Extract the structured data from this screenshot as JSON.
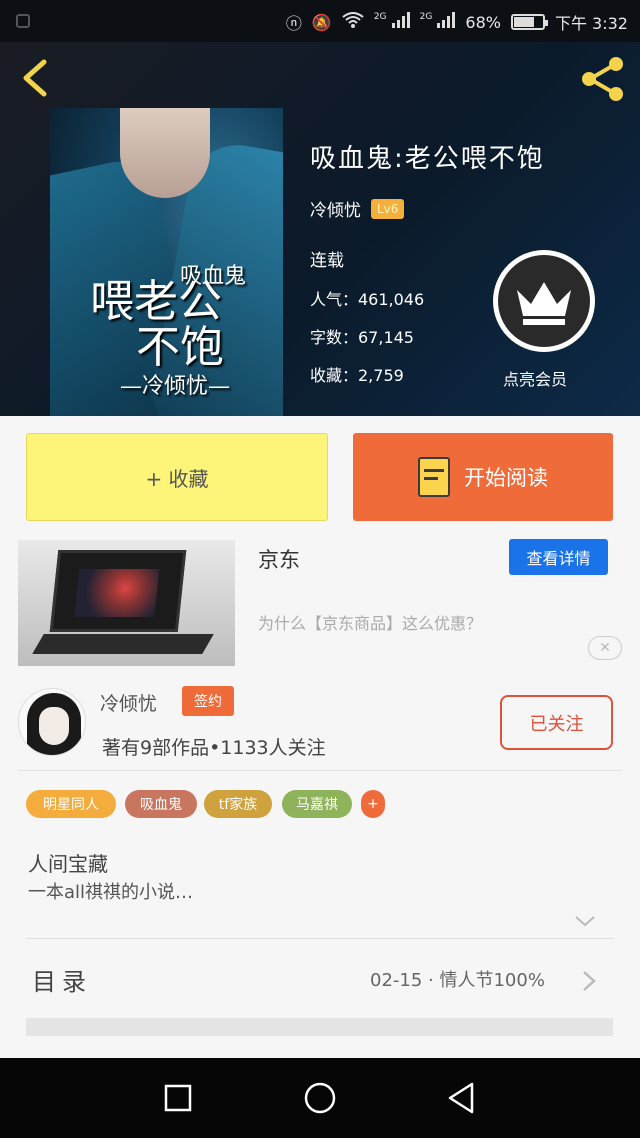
{
  "status_bar": {
    "network1": "2G",
    "network2": "2G",
    "battery": "68%",
    "battery_level": 0.68,
    "time": "下午 3:32"
  },
  "book": {
    "title": "吸血鬼:老公喂不饱",
    "author": "冷倾忧",
    "level": "Lv6",
    "status": "连载",
    "popularity": "人气：461,046",
    "word_count": "字数：67,145",
    "favorites": "收藏：2,759",
    "cover": {
      "line1": "吸血鬼",
      "line2": "喂老公",
      "line3": "不饱",
      "author": "—冷倾忧—"
    }
  },
  "vip": {
    "label": "点亮会员"
  },
  "actions": {
    "collect_label": "+ 收藏",
    "read_label": "开始阅读"
  },
  "ad": {
    "brand": "京东",
    "detail_button": "查看详情",
    "description": "为什么【京东商品】这么优惠？",
    "close": "✕"
  },
  "author_card": {
    "name": "冷倾忧",
    "signed_badge": "签约",
    "meta": "著有9部作品•1133人关注",
    "follow_button": "已关注"
  },
  "tags": [
    {
      "label": "明星同人",
      "color": "#f4ad3d"
    },
    {
      "label": "吸血鬼",
      "color": "#c97660"
    },
    {
      "label": "tf家族",
      "color": "#d0a23d"
    },
    {
      "label": "马嘉祺",
      "color": "#8fb35a"
    },
    {
      "label": "+",
      "color": "#ef6b3a"
    }
  ],
  "intro": {
    "line1": "人间宝藏",
    "line2": "一本all祺祺的小说…"
  },
  "toc": {
    "label": "目录",
    "latest": "02-15 · 情人节100%"
  },
  "colors": {
    "accent_orange": "#ef6b3a",
    "collect_yellow": "#fdf47a",
    "link_blue": "#1a73e8",
    "follow_red": "#e0503a"
  },
  "icons": {
    "back": "chevron-left-icon",
    "share": "share-icon",
    "vip": "crown-icon",
    "read": "book-icon"
  }
}
